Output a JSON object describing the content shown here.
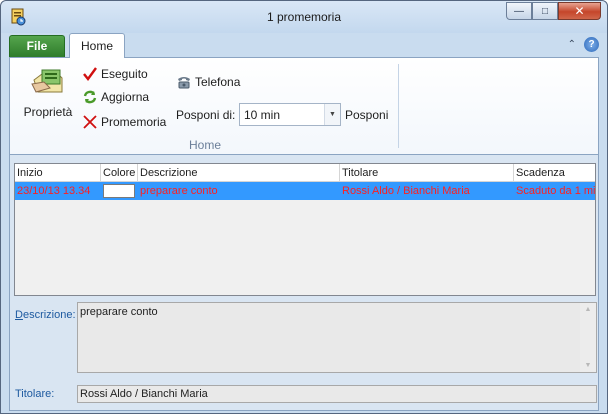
{
  "window": {
    "title": "1 promemoria",
    "controls": [
      "minimize-icon",
      "maximize-icon",
      "close-icon"
    ]
  },
  "ribbon": {
    "tabs": [
      {
        "label": "File",
        "active": false
      },
      {
        "label": "Home",
        "active": true
      }
    ],
    "proprieta_label": "Proprietà",
    "eseguito_label": "Eseguito",
    "aggiorna_label": "Aggiorna",
    "promemoria_label": "Promemoria",
    "telefona_label": "Telefona",
    "posponi_di_label": "Posponi di:",
    "posponi_value": "10 min",
    "posponi_button": "Posponi",
    "group_label": "Home"
  },
  "grid": {
    "columns": [
      "Inizio",
      "Colore",
      "Descrizione",
      "Titolare",
      "Scadenza"
    ],
    "rows": [
      {
        "inizio": "23/10/13  13.34",
        "colore": "#ffffff",
        "descrizione": "preparare conto",
        "titolare": "Rossi Aldo / Bianchi Maria",
        "scadenza": "Scaduto da 1 mi",
        "selected": true
      }
    ]
  },
  "details": {
    "descrizione_label": "Descrizione:",
    "descrizione_value": "preparare conto",
    "titolare_label": "Titolare:",
    "titolare_value": "Rossi Aldo / Bianchi Maria"
  },
  "colors": {
    "selection": "#3399ff",
    "overdue_text": "#ff2020",
    "file_tab": "#2e7c2b",
    "label_blue": "#1e5aa0"
  }
}
